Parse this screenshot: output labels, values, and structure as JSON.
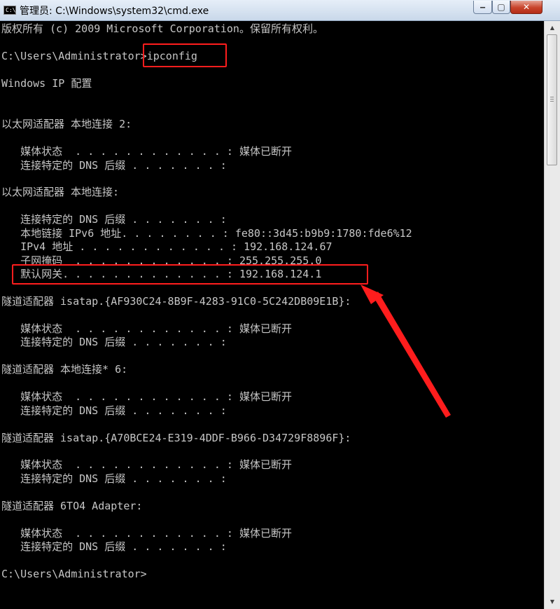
{
  "window": {
    "icon_text": "C:\\",
    "title": "管理员: C:\\Windows\\system32\\cmd.exe",
    "controls": {
      "minimize": "‒",
      "maximize": "▢",
      "close": "✕"
    }
  },
  "console": {
    "lines": [
      "版权所有 (c) 2009 Microsoft Corporation。保留所有权利。",
      "",
      "C:\\Users\\Administrator>ipconfig",
      "",
      "Windows IP 配置",
      "",
      "",
      "以太网适配器 本地连接 2:",
      "",
      "   媒体状态  . . . . . . . . . . . . : 媒体已断开",
      "   连接特定的 DNS 后缀 . . . . . . . :",
      "",
      "以太网适配器 本地连接:",
      "",
      "   连接特定的 DNS 后缀 . . . . . . . :",
      "   本地链接 IPv6 地址. . . . . . . . : fe80::3d45:b9b9:1780:fde6%12",
      "   IPv4 地址 . . . . . . . . . . . . : 192.168.124.67",
      "   子网掩码  . . . . . . . . . . . . : 255.255.255.0",
      "   默认网关. . . . . . . . . . . . . : 192.168.124.1",
      "",
      "隧道适配器 isatap.{AF930C24-8B9F-4283-91C0-5C242DB09E1B}:",
      "",
      "   媒体状态  . . . . . . . . . . . . : 媒体已断开",
      "   连接特定的 DNS 后缀 . . . . . . . :",
      "",
      "隧道适配器 本地连接* 6:",
      "",
      "   媒体状态  . . . . . . . . . . . . : 媒体已断开",
      "   连接特定的 DNS 后缀 . . . . . . . :",
      "",
      "隧道适配器 isatap.{A70BCE24-E319-4DDF-B966-D34729F8896F}:",
      "",
      "   媒体状态  . . . . . . . . . . . . : 媒体已断开",
      "   连接特定的 DNS 后缀 . . . . . . . :",
      "",
      "隧道适配器 6TO4 Adapter:",
      "",
      "   媒体状态  . . . . . . . . . . . . : 媒体已断开",
      "   连接特定的 DNS 后缀 . . . . . . . :",
      "",
      "C:\\Users\\Administrator>"
    ]
  },
  "scrollbar": {
    "up_arrow": "▲",
    "down_arrow": "▼"
  },
  "annotation": {
    "color": "#ff1d1d"
  }
}
